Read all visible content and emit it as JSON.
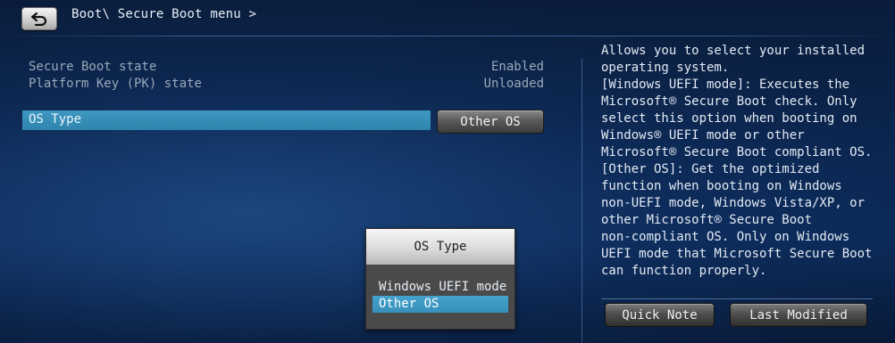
{
  "header": {
    "breadcrumb": "Boot\\ Secure Boot menu >",
    "back_icon": "back-arrow-icon"
  },
  "settings": {
    "secure_boot_state": {
      "label": "Secure Boot state",
      "value": "Enabled"
    },
    "platform_key_state": {
      "label": "Platform Key (PK) state",
      "value": "Unloaded"
    },
    "os_type": {
      "label": "OS Type",
      "value": "Other OS"
    }
  },
  "popup": {
    "title": "OS Type",
    "options": [
      "Windows UEFI mode",
      "Other OS"
    ],
    "selected_index": 1
  },
  "help": {
    "lines": [
      "Allows you to select your installed",
      "operating system.",
      "[Windows UEFI mode]: Executes the",
      "Microsoft® Secure Boot check. Only",
      "select this option when booting on",
      "Windows® UEFI mode or other",
      "Microsoft® Secure Boot compliant OS.",
      "[Other OS]: Get the optimized",
      "function when booting on Windows",
      "non-UEFI mode, Windows Vista/XP, or",
      "other Microsoft® Secure Boot",
      "non-compliant OS. Only on Windows",
      "UEFI mode that Microsoft Secure Boot",
      "can function properly."
    ]
  },
  "footer": {
    "quick_note": "Quick Note",
    "last_modified": "Last Modified"
  },
  "colors": {
    "highlight": "#2e84ad",
    "background": "#0b2650"
  }
}
